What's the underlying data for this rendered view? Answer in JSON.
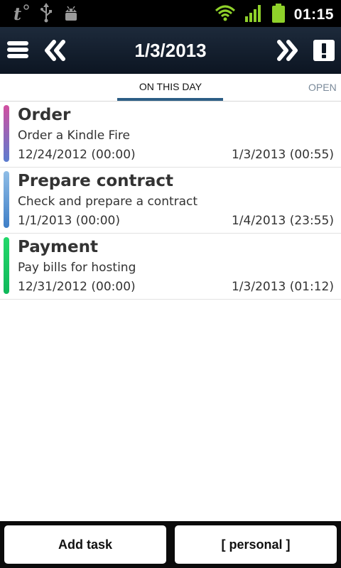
{
  "status_bar": {
    "time": "01:15",
    "icons": [
      "tasks-app-icon",
      "usb-icon",
      "android-debug-icon",
      "wifi-icon",
      "signal-icon",
      "battery-icon"
    ]
  },
  "header": {
    "title": "1/3/2013",
    "icons": [
      "menu-icon",
      "previous-day-icon",
      "next-day-icon",
      "alert-icon"
    ]
  },
  "tabs": {
    "active": "ON THIS DAY",
    "next": "OPEN"
  },
  "tasks": [
    {
      "name": "Order",
      "description": "Order a Kindle Fire",
      "start": "12/24/2012 (00:00)",
      "end": "1/3/2013 (00:55)",
      "color": "#d24fa0",
      "color2": "#5b7ccf"
    },
    {
      "name": "Prepare contract",
      "description": "Check and prepare a contract",
      "start": "1/1/2013 (00:00)",
      "end": "1/4/2013 (23:55)",
      "color": "#8fbde6",
      "color2": "#3e7ec7"
    },
    {
      "name": "Payment",
      "description": "Pay bills for hosting",
      "start": "12/31/2012 (00:00)",
      "end": "1/3/2013 (01:12)",
      "color": "#23d86a",
      "color2": "#0fb85a"
    }
  ],
  "bottom": {
    "add_label": "Add task",
    "list_label": "[ personal ]"
  }
}
